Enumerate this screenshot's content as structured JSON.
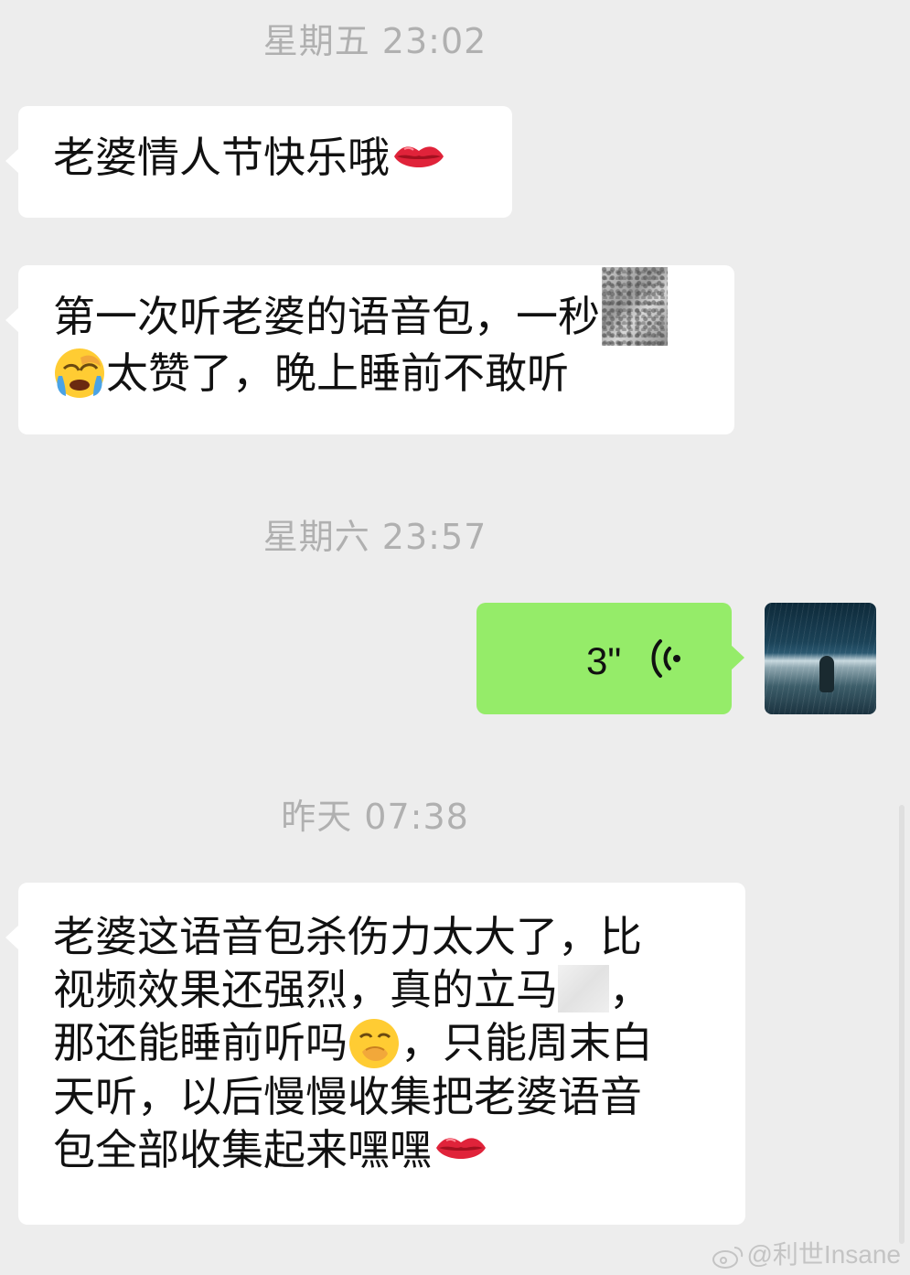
{
  "timestamps": {
    "t1": "星期五 23:02",
    "t2": "星期六 23:57",
    "t3": "昨天 07:38"
  },
  "messages": {
    "m1": {
      "text": "老婆情人节快乐哦",
      "emoji": "kiss-mark-icon"
    },
    "m2": {
      "line1": "第一次听老婆的语音包，一秒",
      "line2": "太赞了，晚上睡前不敢听",
      "emoji_inline_image": "sticker-image",
      "emoji_face": "face-with-tears-icon"
    },
    "voice": {
      "duration": "3\"",
      "icon": "voice-wave-icon"
    },
    "m3": {
      "line1": "老婆这语音包杀伤力太大了，比",
      "line2a": "视频效果还强烈，真的立马",
      "line2b": "，",
      "line3a": "那还能睡前听吗",
      "line3b": "，只能周末白",
      "line4": "天听，以后慢慢收集把老婆语音",
      "line5": "包全部收集起来嘿嘿",
      "emoji_face": "face-hand-over-mouth-icon",
      "emoji_end": "kiss-mark-icon"
    }
  },
  "watermark": {
    "text": "@利世Insane",
    "icon": "weibo-icon"
  },
  "colors": {
    "background": "#ededed",
    "incoming_bubble": "#ffffff",
    "outgoing_bubble": "#95ec69",
    "timestamp": "#b0b0b0"
  }
}
